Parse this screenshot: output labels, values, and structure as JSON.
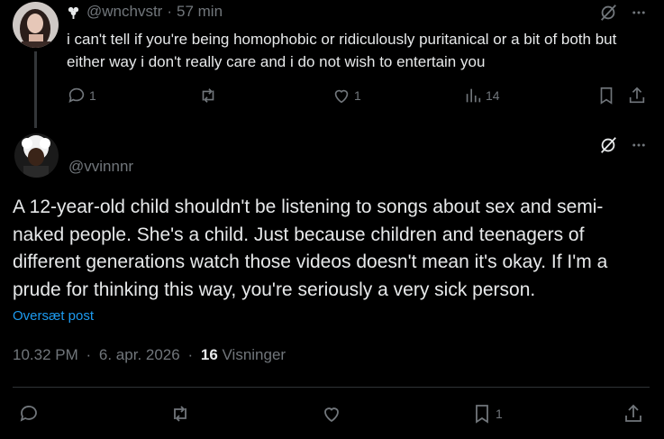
{
  "parent_tweet": {
    "handle": "@wnchvstr",
    "separator": "·",
    "time": "57 min",
    "badge_icon": "flower-badge-icon",
    "text": "i can't tell if you're being homophobic or ridiculously puritanical or a bit of both but either way i don't really care and i do not wish to entertain you",
    "actions": {
      "replies": "1",
      "reposts": "",
      "likes": "1",
      "views": "14"
    }
  },
  "main_tweet": {
    "handle": "@vvinnnr",
    "text": "A 12-year-old child shouldn't be listening to songs about sex and semi-naked people. She's a child. Just because children and teenagers of different generations watch those videos doesn't mean it's okay. If I'm a prude for thinking this way, you're seriously a very sick person.",
    "translate_label": "Oversæt post",
    "timestamp": "10.32 PM",
    "date": "6. apr. 2026",
    "separator": "·",
    "views_count": "16",
    "views_label": "Visninger",
    "actions": {
      "bookmarks": "1"
    }
  },
  "colors": {
    "background": "#000000",
    "text_primary": "#e7e9ea",
    "text_secondary": "#71767b",
    "link": "#1d9bf0",
    "divider": "#2f3336"
  }
}
